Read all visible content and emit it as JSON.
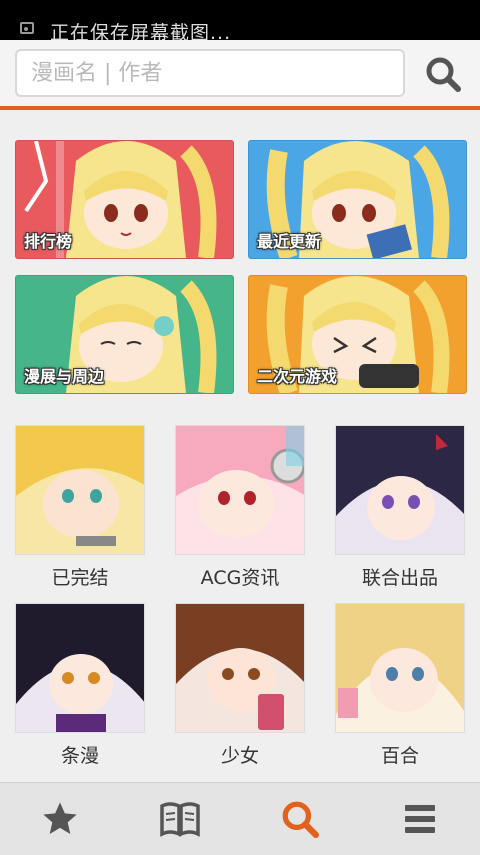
{
  "status_bar": {
    "notification": "正在保存屏幕截图..."
  },
  "search": {
    "placeholder": "漫画名 | 作者",
    "value": ""
  },
  "featured": [
    {
      "label": "排行榜",
      "bg": "#e85a5e"
    },
    {
      "label": "最近更新",
      "bg": "#4aa6e4"
    },
    {
      "label": "漫展与周边",
      "bg": "#46b58a"
    },
    {
      "label": "二次元游戏",
      "bg": "#f2a12e"
    }
  ],
  "categories": [
    {
      "label": "已完结"
    },
    {
      "label": "ACG资讯"
    },
    {
      "label": "联合出品"
    },
    {
      "label": "条漫"
    },
    {
      "label": "少女"
    },
    {
      "label": "百合"
    }
  ],
  "bottom_nav": {
    "items": [
      {
        "name": "favorites",
        "icon": "star-icon"
      },
      {
        "name": "bookshelf",
        "icon": "book-icon"
      },
      {
        "name": "search",
        "icon": "search-icon",
        "active": true
      },
      {
        "name": "menu",
        "icon": "menu-icon"
      }
    ],
    "active_color": "#e2611d",
    "inactive_color": "#555555"
  },
  "colors": {
    "accent": "#e2611d"
  }
}
